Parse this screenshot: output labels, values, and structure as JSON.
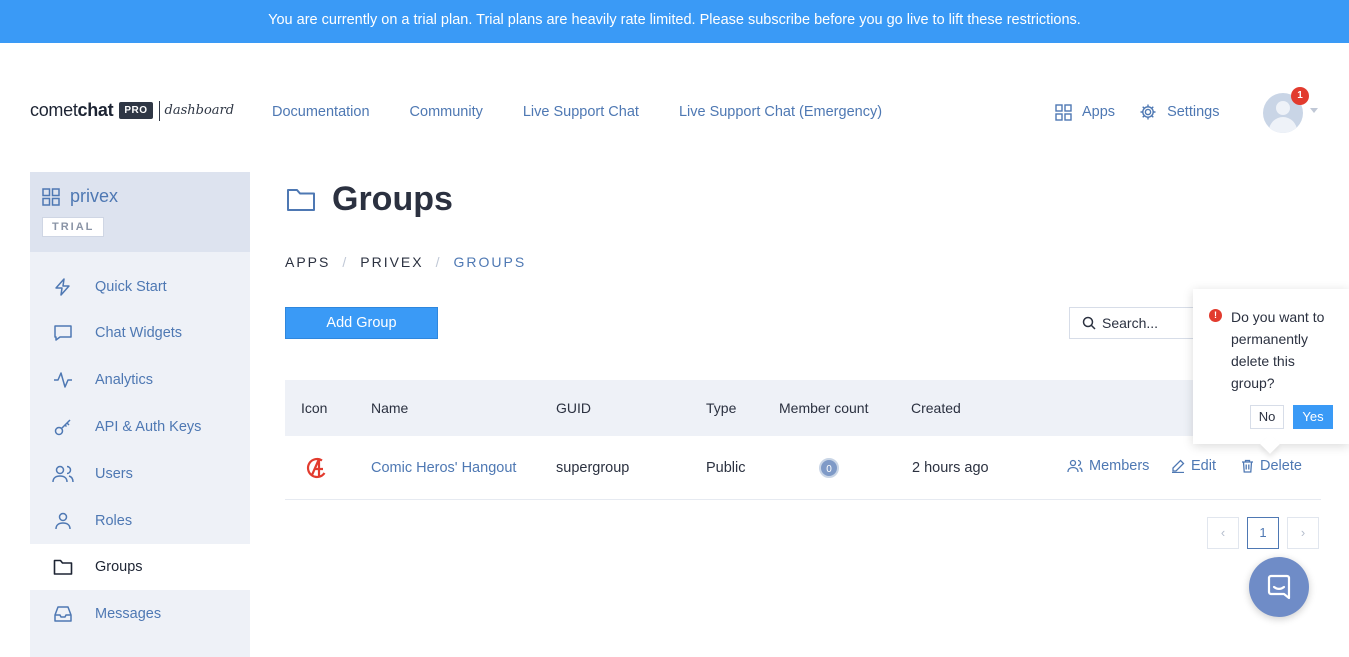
{
  "banner": {
    "text": "You are currently on a trial plan. Trial plans are heavily rate limited. Please subscribe before you go live to lift these restrictions."
  },
  "brand": {
    "name_regular": "comet",
    "name_bold": "chat",
    "badge": "PRO",
    "suffix": "dashboard"
  },
  "topnav": {
    "items": [
      {
        "label": "Documentation"
      },
      {
        "label": "Community"
      },
      {
        "label": "Live Support Chat"
      },
      {
        "label": "Live Support Chat (Emergency)"
      }
    ]
  },
  "topright": {
    "apps": "Apps",
    "settings": "Settings",
    "notification_count": "1"
  },
  "sidebar": {
    "app_name": "privex",
    "plan_badge": "TRIAL",
    "items": [
      {
        "label": "Quick Start",
        "icon": "bolt-icon"
      },
      {
        "label": "Chat Widgets",
        "icon": "chat-bubble-icon"
      },
      {
        "label": "Analytics",
        "icon": "activity-icon"
      },
      {
        "label": "API & Auth Keys",
        "icon": "key-icon"
      },
      {
        "label": "Users",
        "icon": "users-icon"
      },
      {
        "label": "Roles",
        "icon": "user-icon"
      },
      {
        "label": "Groups",
        "icon": "folder-icon"
      },
      {
        "label": "Messages",
        "icon": "inbox-icon"
      }
    ],
    "active": "Groups"
  },
  "page": {
    "title": "Groups",
    "breadcrumb": [
      "APPS",
      "PRIVEX",
      "GROUPS"
    ],
    "add_button": "Add Group",
    "search_placeholder": "Search..."
  },
  "table": {
    "columns": [
      "Icon",
      "Name",
      "GUID",
      "Type",
      "Member count",
      "Created"
    ],
    "rows": [
      {
        "name": "Comic Heros' Hangout",
        "guid": "supergroup",
        "type": "Public",
        "member_count": "0",
        "created": "2 hours ago"
      }
    ],
    "actions": {
      "members": "Members",
      "edit": "Edit",
      "delete": "Delete"
    }
  },
  "pagination": {
    "prev": "‹",
    "current": "1",
    "next": "›"
  },
  "popover": {
    "message": "Do you want to permanently delete this group?",
    "no": "No",
    "yes": "Yes",
    "icon": "!"
  },
  "colors": {
    "primary": "#3a9af6",
    "link": "#4e78b3",
    "sidebar_bg": "#eef1f7",
    "danger": "#e23b2e"
  }
}
